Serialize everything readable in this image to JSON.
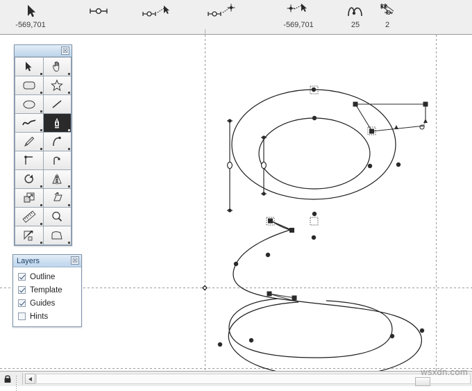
{
  "toolbar": {
    "items": [
      {
        "icon": "arrow-cursor-icon",
        "label": "-569,701",
        "name": "pointer-coordinate-tool"
      },
      {
        "icon": "node-segment-icon",
        "label": "",
        "name": "segment-tool"
      },
      {
        "icon": "node-segment-cursor-icon",
        "label": "",
        "name": "segment-select-tool"
      },
      {
        "icon": "node-segment-node-icon",
        "label": "",
        "name": "segment-node-tool"
      },
      {
        "icon": "node-cursor-icon",
        "label": "-569,701",
        "name": "node-coordinate-tool"
      },
      {
        "icon": "curve-wave-icon",
        "label": "25",
        "name": "curve-tension-tool"
      },
      {
        "icon": "node-cluster-icon",
        "label": "2",
        "name": "node-count-tool"
      }
    ]
  },
  "toolbox": {
    "title": "",
    "close_label": "☒",
    "tools": [
      {
        "name": "select-arrow-tool",
        "icon": "arrow-cursor-icon",
        "active": false
      },
      {
        "name": "pan-hand-tool",
        "icon": "hand-icon",
        "active": false
      },
      {
        "name": "rectangle-tool",
        "icon": "rounded-rect-icon",
        "active": false
      },
      {
        "name": "star-tool",
        "icon": "star-icon",
        "active": false
      },
      {
        "name": "ellipse-tool",
        "icon": "ellipse-icon",
        "active": false
      },
      {
        "name": "line-tool",
        "icon": "line-icon",
        "active": false
      },
      {
        "name": "freehand-curve-tool",
        "icon": "wave-curve-icon",
        "active": false
      },
      {
        "name": "pen-nib-tool",
        "icon": "pen-nib-icon",
        "active": true
      },
      {
        "name": "knife-tool",
        "icon": "knife-icon",
        "active": false
      },
      {
        "name": "arc-tool",
        "icon": "arc-icon",
        "active": false
      },
      {
        "name": "corner-tool",
        "icon": "corner-icon",
        "active": false
      },
      {
        "name": "hook-tool",
        "icon": "hook-icon",
        "active": false
      },
      {
        "name": "rotate-tool",
        "icon": "rotate-arrow-icon",
        "active": false
      },
      {
        "name": "mirror-tool",
        "icon": "mirror-icon",
        "active": false
      },
      {
        "name": "duplicate-tool",
        "icon": "duplicate-squares-icon",
        "active": false
      },
      {
        "name": "skew-tool",
        "icon": "skew-icon",
        "active": false
      },
      {
        "name": "measure-ruler-tool",
        "icon": "ruler-icon",
        "active": false
      },
      {
        "name": "zoom-magnifier-tool",
        "icon": "magnifier-icon",
        "active": false
      },
      {
        "name": "scale-tool",
        "icon": "scale-arrow-icon",
        "active": false
      },
      {
        "name": "shape-fill-tool",
        "icon": "shape-fill-icon",
        "active": false
      }
    ]
  },
  "layers": {
    "title": "Layers",
    "close_label": "☒",
    "items": [
      {
        "label": "Outline",
        "checked": true
      },
      {
        "label": "Template",
        "checked": true
      },
      {
        "label": "Guides",
        "checked": true
      },
      {
        "label": "Hints",
        "checked": false
      }
    ]
  },
  "statusbar": {
    "lock_icon": "lock-icon",
    "scroll_left_icon": "scroll-left-arrow-icon"
  },
  "watermark": {
    "text": "wsxdn.com"
  },
  "canvas": {
    "glyph": "g",
    "colors": {
      "outline": "#1c1c1c",
      "guide": "#9a9a9a",
      "handle": "#2a2a2a",
      "background": "#ffffff"
    }
  }
}
